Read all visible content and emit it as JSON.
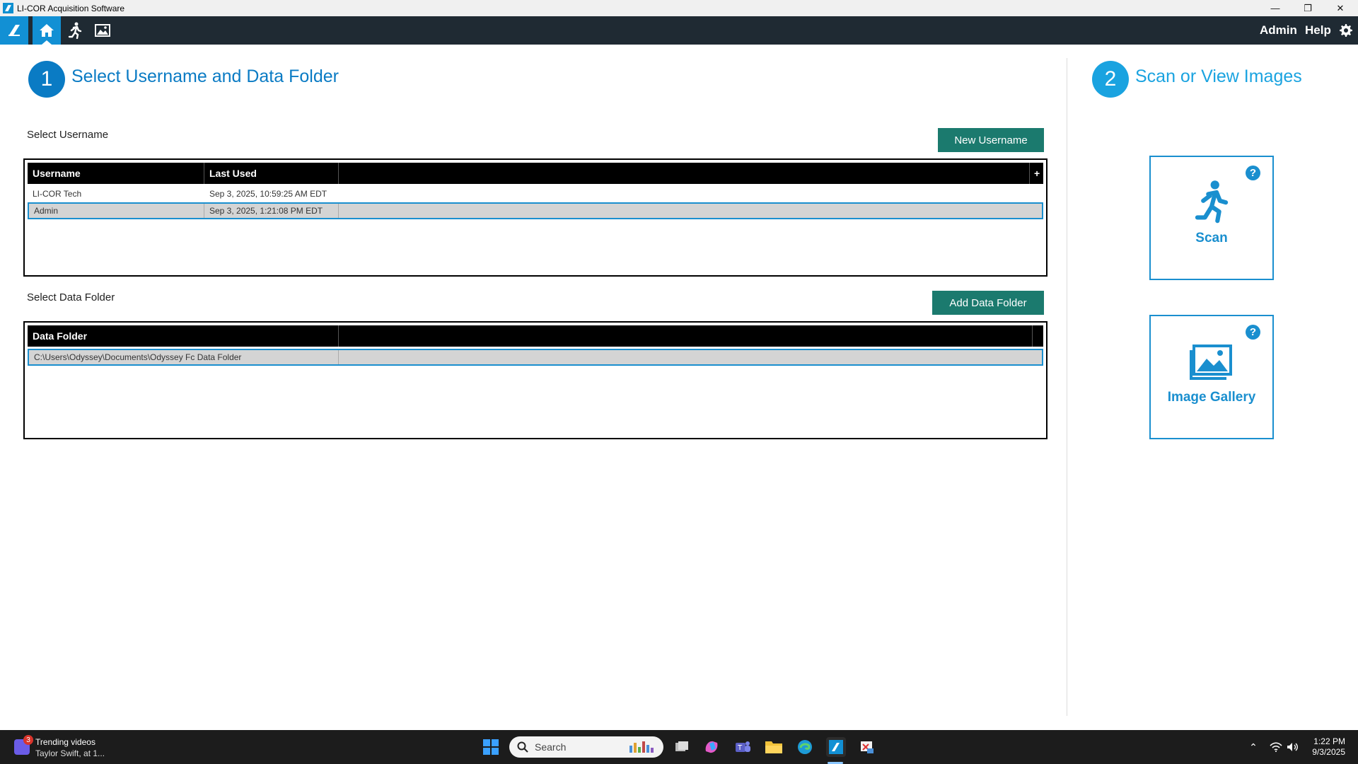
{
  "window": {
    "title": "LI-COR Acquisition Software",
    "controls": {
      "minimize": "—",
      "maximize": "❐",
      "close": "✕"
    }
  },
  "toolbar": {
    "icons": [
      "licor-logo-icon",
      "home-icon",
      "running-person-icon",
      "image-icon"
    ],
    "admin_label": "Admin",
    "help_label": "Help",
    "settings_icon": "gear-icon",
    "colors": {
      "bar": "#1f2a33",
      "active": "#1290d4"
    }
  },
  "step1": {
    "number": "1",
    "title": "Select Username and Data Folder",
    "color": "#0a7bc4"
  },
  "username_section": {
    "label": "Select Username",
    "new_button": "New Username",
    "columns": [
      "Username",
      "Last Used"
    ],
    "add_column_glyph": "+",
    "rows": [
      {
        "username": "LI-COR Tech",
        "last_used": "Sep 3, 2025, 10:59:25 AM EDT",
        "selected": false
      },
      {
        "username": "Admin",
        "last_used": "Sep 3, 2025, 1:21:08 PM EDT",
        "selected": true
      }
    ]
  },
  "folder_section": {
    "label": "Select Data Folder",
    "add_button": "Add Data Folder",
    "columns": [
      "Data Folder"
    ],
    "rows": [
      {
        "path": "C:\\Users\\Odyssey\\Documents\\Odyssey Fc Data Folder",
        "selected": true
      }
    ]
  },
  "step2": {
    "number": "2",
    "title": "Scan or View Images",
    "color": "#1aa3e0"
  },
  "cards": {
    "scan": {
      "label": "Scan",
      "icon": "running-person-icon",
      "help": "?"
    },
    "gallery": {
      "label": "Image Gallery",
      "icon": "image-icon",
      "help": "?"
    }
  },
  "taskbar": {
    "news_badge": "3",
    "news_title": "Trending videos",
    "news_sub": "Taylor Swift, at 1...",
    "search_placeholder": "Search",
    "time": "1:22 PM",
    "date": "9/3/2025",
    "tray_chevron": "⌃"
  }
}
